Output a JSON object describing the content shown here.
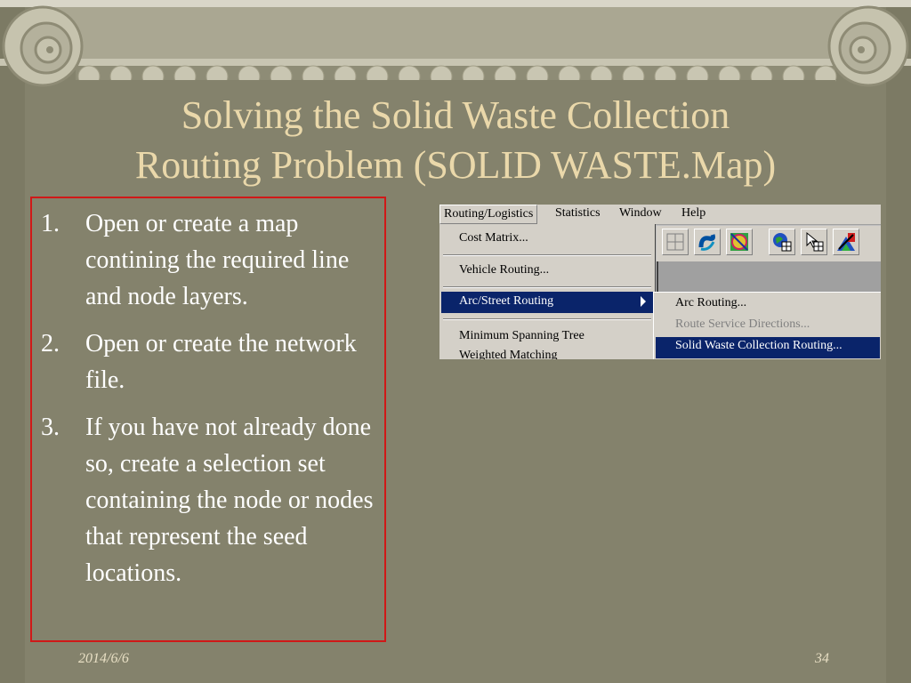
{
  "slide": {
    "title_line1": "Solving the Solid Waste Collection",
    "title_line2": "Routing Problem  (SOLID WASTE.Map)",
    "date": "2014/6/6",
    "page_number": "34"
  },
  "steps": [
    {
      "num": "1.",
      "text": "Open or create a map contining the required line and node layers."
    },
    {
      "num": "2.",
      "text": "Open or create the network file."
    },
    {
      "num": "3.",
      "text": "If you have not already done so, create a selection set containing the node or nodes that represent the seed locations."
    }
  ],
  "app": {
    "menubar": [
      "Routing/Logistics",
      "Statistics",
      "Window",
      "Help"
    ],
    "dropdown": {
      "cost_matrix": "Cost Matrix...",
      "vehicle_routing": "Vehicle Routing...",
      "arc_street_routing": "Arc/Street Routing",
      "minimum_spanning_tree": "Minimum Spanning Tree",
      "weighted_matching": "Weighted Matching"
    },
    "submenu": {
      "arc_routing": "Arc Routing...",
      "route_service_directions": "Route Service Directions...",
      "solid_waste_collection_routing": "Solid Waste Collection Routing..."
    },
    "toolbar_icons": [
      "grid-icon",
      "route-shape-icon",
      "map-palette-icon",
      "globe-grid-icon",
      "pointer-grid-icon",
      "color-map-icon"
    ]
  },
  "colors": {
    "background": "#84826c",
    "title": "#ead8aa",
    "body_text": "#ffffff",
    "frame_border": "#d01818",
    "menu_highlight": "#0a246a"
  }
}
